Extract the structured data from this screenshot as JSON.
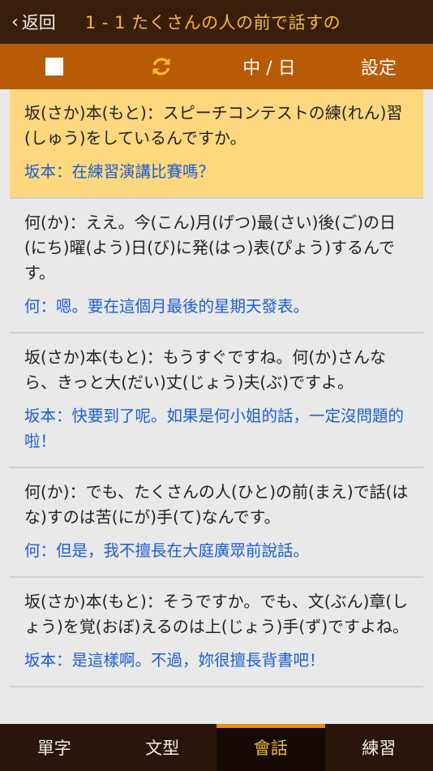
{
  "nav": {
    "back_label": "返回",
    "title": "1 - 1 たくさんの人の前で話すの"
  },
  "toolbar": {
    "lang_toggle": "中 / 日",
    "settings": "設定"
  },
  "colors": {
    "accent": "#f2b93a",
    "toolbar_bg": "#b85b06",
    "highlight": "#fed77f",
    "zh_text": "#1b5fd1"
  },
  "dialogue": [
    {
      "jp": "坂(さか)本(もと)：スピーチコンテストの練(れん)習(しゅう)をしているんですか。",
      "zh": "坂本：在練習演講比賽嗎？",
      "active": true
    },
    {
      "jp": "何(か)：ええ。今(こん)月(げつ)最(さい)後(ご)の日(にち)曜(よう)日(び)に発(はっ)表(ぴょう)するんです。",
      "zh": "何：嗯。要在這個月最後的星期天發表。"
    },
    {
      "jp": "坂(さか)本(もと)：もうすぐですね。何(か)さんなら、きっと大(だい)丈(じょう)夫(ぶ)ですよ。",
      "zh": "坂本：快要到了呢。如果是何小姐的話，一定沒問題的啦！"
    },
    {
      "jp": "何(か)：でも、たくさんの人(ひと)の前(まえ)で話(はな)すのは苦(にが)手(て)なんです。",
      "zh": "何：但是，我不擅長在大庭廣眾前說話。"
    },
    {
      "jp": "坂(さか)本(もと)：そうですか。でも、文(ぶん)章(しょう)を覚(おぼ)えるのは上(じょう)手(ず)ですよね。",
      "zh": "坂本：是這樣啊。不過，妳很擅長背書吧！"
    }
  ],
  "tabs": [
    {
      "label": "單字"
    },
    {
      "label": "文型"
    },
    {
      "label": "會話",
      "active": true
    },
    {
      "label": "練習"
    }
  ]
}
